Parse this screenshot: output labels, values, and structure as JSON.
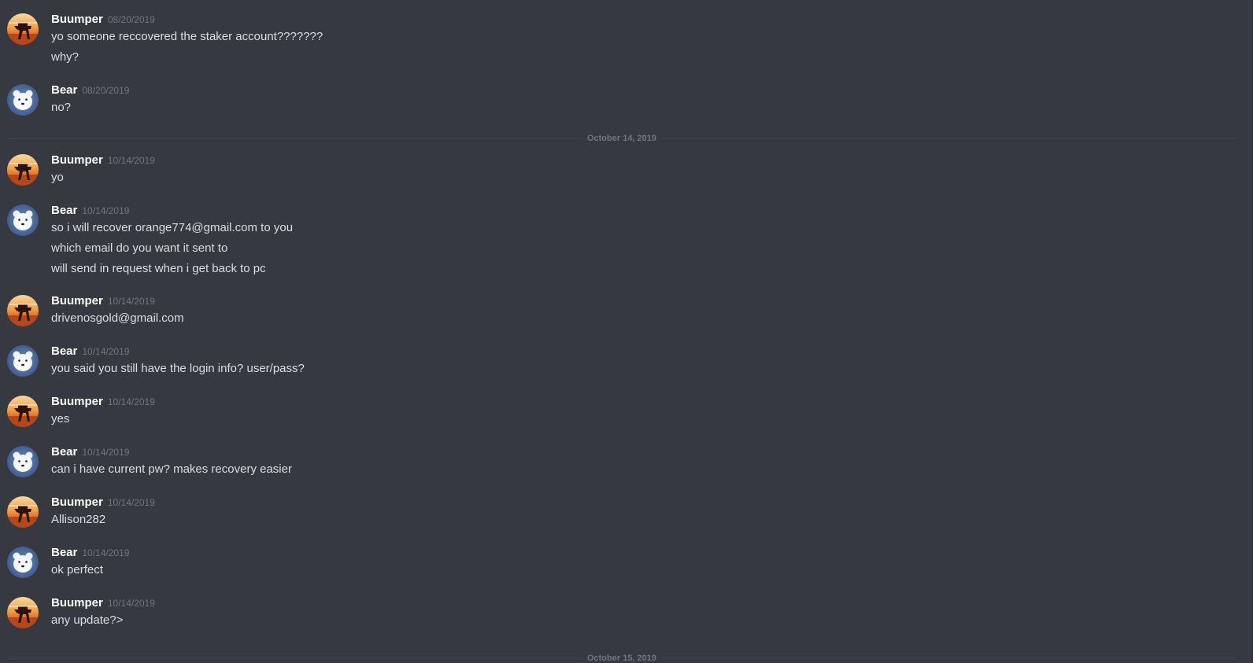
{
  "date_dividers": [
    "October 14, 2019",
    "October 15, 2019"
  ],
  "groups": [
    {
      "author": "Buumper",
      "avatar": "buumper",
      "timestamp": "08/20/2019",
      "messages": [
        "yo someone reccovered the staker account???????",
        "why?"
      ]
    },
    {
      "author": "Bear",
      "avatar": "bear",
      "timestamp": "08/20/2019",
      "messages": [
        "no?"
      ]
    },
    {
      "author": "Buumper",
      "avatar": "buumper",
      "timestamp": "10/14/2019",
      "messages": [
        "yo"
      ]
    },
    {
      "author": "Bear",
      "avatar": "bear",
      "timestamp": "10/14/2019",
      "messages": [
        "so i will recover orange774@gmail.com to you",
        "which email do you want it sent to",
        "will send in request when i get back to pc"
      ]
    },
    {
      "author": "Buumper",
      "avatar": "buumper",
      "timestamp": "10/14/2019",
      "messages": [
        "drivenosgold@gmail.com"
      ]
    },
    {
      "author": "Bear",
      "avatar": "bear",
      "timestamp": "10/14/2019",
      "messages": [
        "you said you still have the login info? user/pass?"
      ]
    },
    {
      "author": "Buumper",
      "avatar": "buumper",
      "timestamp": "10/14/2019",
      "messages": [
        "yes"
      ]
    },
    {
      "author": "Bear",
      "avatar": "bear",
      "timestamp": "10/14/2019",
      "messages": [
        "can i have current pw? makes recovery easier"
      ]
    },
    {
      "author": "Buumper",
      "avatar": "buumper",
      "timestamp": "10/14/2019",
      "messages": [
        "Allison282"
      ]
    },
    {
      "author": "Bear",
      "avatar": "bear",
      "timestamp": "10/14/2019",
      "messages": [
        "ok perfect"
      ]
    },
    {
      "author": "Buumper",
      "avatar": "buumper",
      "timestamp": "10/14/2019",
      "messages": [
        "any update?>"
      ]
    }
  ],
  "colors": {
    "background": "#36393f",
    "username": "#ffffff",
    "timestamp": "#72767d",
    "message_text": "#dcddde"
  }
}
